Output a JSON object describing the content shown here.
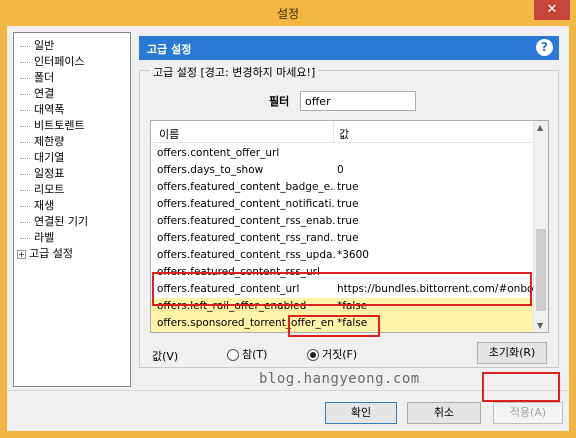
{
  "window": {
    "title": "설정",
    "close_label": "✕"
  },
  "sidebar": {
    "items": [
      {
        "label": "일반"
      },
      {
        "label": "인터페이스"
      },
      {
        "label": "폴더"
      },
      {
        "label": "연결"
      },
      {
        "label": "대역폭"
      },
      {
        "label": "비트토렌트"
      },
      {
        "label": "제한량"
      },
      {
        "label": "대기열"
      },
      {
        "label": "일정표"
      },
      {
        "label": "리모트"
      },
      {
        "label": "재생"
      },
      {
        "label": "연결된 기기"
      },
      {
        "label": "라벨"
      },
      {
        "label": "고급 설정",
        "expandable": true
      }
    ]
  },
  "panel": {
    "title": "고급 설정",
    "help": "?"
  },
  "group": {
    "label": "고급 설정 [경고: 변경하지 마세요!]"
  },
  "filter": {
    "label": "필터",
    "value": "offer"
  },
  "list": {
    "columns": [
      "이름",
      "값"
    ],
    "rows": [
      {
        "name": "offers.content_offer_url",
        "value": ""
      },
      {
        "name": "offers.days_to_show",
        "value": "0"
      },
      {
        "name": "offers.featured_content_badge_e...",
        "value": "true"
      },
      {
        "name": "offers.featured_content_notificati...",
        "value": "true"
      },
      {
        "name": "offers.featured_content_rss_enab...",
        "value": "true"
      },
      {
        "name": "offers.featured_content_rss_rand...",
        "value": "true"
      },
      {
        "name": "offers.featured_content_rss_upda...",
        "value": "*3600"
      },
      {
        "name": "offers.featured_content_rss_url",
        "value": ""
      },
      {
        "name": "offers.featured_content_url",
        "value": "https://bundles.bittorrent.com/#onbo..."
      },
      {
        "name": "offers.left_rail_offer_enabled",
        "value": "*false",
        "highlighted": true
      },
      {
        "name": "offers.sponsored_torrent_offer_en...",
        "value": "*false",
        "highlighted": true
      }
    ]
  },
  "value_editor": {
    "label": "값(V)",
    "true_label": "참(T)",
    "false_label": "거짓(F)",
    "selected": "false",
    "reset_label": "초기화(R)"
  },
  "watermark": "blog.hangyeong.com",
  "buttons": {
    "ok": "확인",
    "cancel": "취소",
    "apply": "적용(A)"
  },
  "colors": {
    "title_bar": "#f3b844",
    "panel_header": "#2b79d6",
    "highlight": "#fff3a8",
    "annotation_red": "#e02020"
  }
}
